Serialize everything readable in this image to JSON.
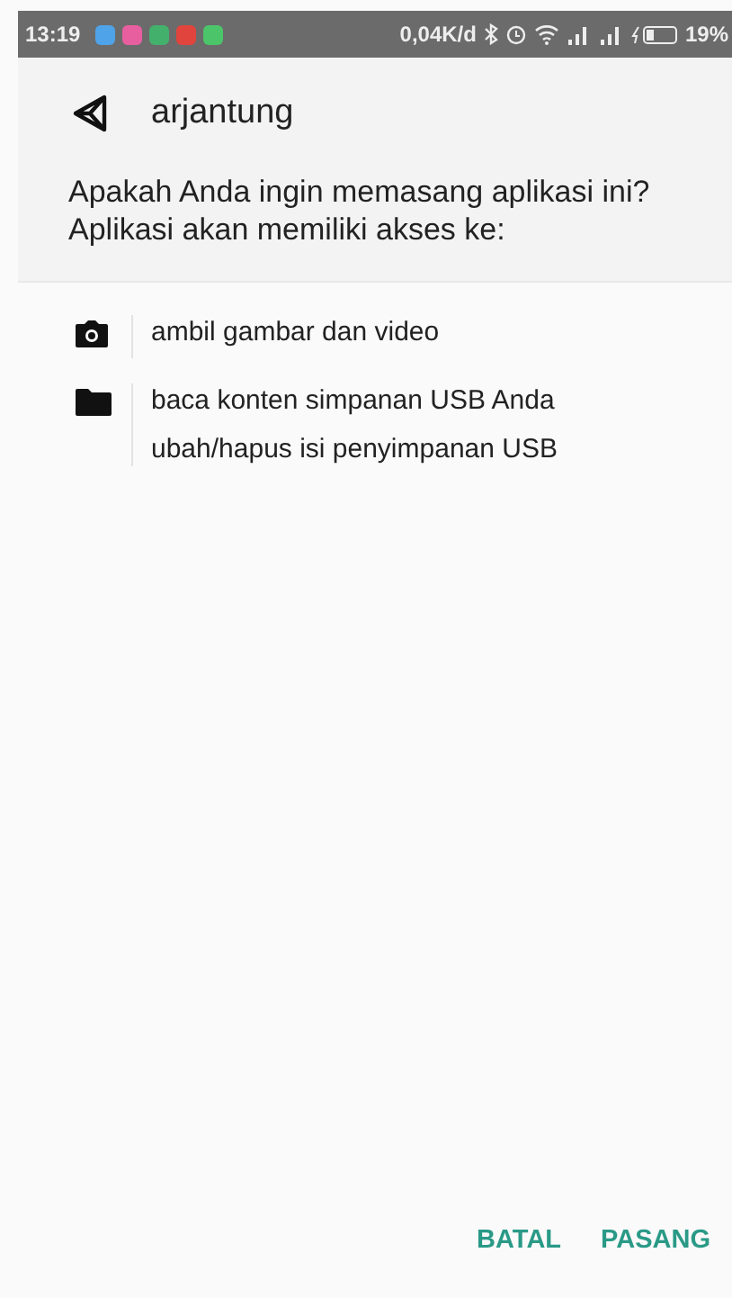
{
  "status_bar": {
    "time": "13:19",
    "speed": "0,04K/d",
    "battery": "19%"
  },
  "app": {
    "name": "arjantung"
  },
  "prompt": "Apakah Anda ingin memasang aplikasi ini? Aplikasi akan memiliki akses ke:",
  "permissions": [
    {
      "kind": "camera",
      "lines": [
        "ambil gambar dan video"
      ]
    },
    {
      "kind": "folder",
      "lines": [
        "baca konten simpanan USB Anda",
        "ubah/hapus isi penyimpanan USB"
      ]
    }
  ],
  "buttons": [
    "BATAL",
    "PASANG"
  ]
}
